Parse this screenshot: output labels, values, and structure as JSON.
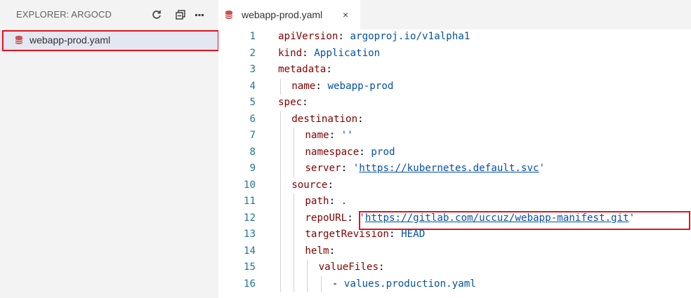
{
  "sidebar": {
    "title": "EXPLORER: ARGOCD",
    "files": [
      {
        "label": "webapp-prod.yaml",
        "selected": true,
        "highlighted": true
      }
    ],
    "header_icons": [
      "refresh-icon",
      "collapse-all-icon",
      "more-icon"
    ]
  },
  "tab": {
    "label": "webapp-prod.yaml",
    "close": "×"
  },
  "editor": {
    "lines": [
      {
        "n": "1",
        "key": "apiVersion",
        "sep": ": ",
        "val": "argoproj.io/v1alpha1"
      },
      {
        "n": "2",
        "key": "kind",
        "sep": ": ",
        "val": "Application"
      },
      {
        "n": "3",
        "key": "metadata",
        "sep": ":",
        "val": ""
      },
      {
        "n": "4",
        "key": "name",
        "sep": ": ",
        "val": "webapp-prod"
      },
      {
        "n": "5",
        "key": "spec",
        "sep": ":",
        "val": ""
      },
      {
        "n": "6",
        "key": "destination",
        "sep": ":",
        "val": ""
      },
      {
        "n": "7",
        "key": "name",
        "sep": ": ",
        "val": "''"
      },
      {
        "n": "8",
        "key": "namespace",
        "sep": ": ",
        "val": "prod"
      },
      {
        "n": "9",
        "key": "server",
        "sep": ": ",
        "q1": "'",
        "url": "https://kubernetes.default.svc",
        "q2": "'"
      },
      {
        "n": "10",
        "key": "source",
        "sep": ":",
        "val": ""
      },
      {
        "n": "11",
        "key": "path",
        "sep": ": ",
        "val": "."
      },
      {
        "n": "12",
        "key": "repoURL",
        "sep": ": ",
        "q1": "'",
        "url": "https://gitlab.com/uccuz/webapp-manifest.git",
        "q2": "'",
        "highlighted": true
      },
      {
        "n": "13",
        "key": "targetRevision",
        "sep": ": ",
        "val": "HEAD"
      },
      {
        "n": "14",
        "key": "helm",
        "sep": ":",
        "val": ""
      },
      {
        "n": "15",
        "key": "valueFiles",
        "sep": ":",
        "val": ""
      },
      {
        "n": "16",
        "dash": "- ",
        "val": "values.production.yaml"
      }
    ]
  },
  "colors": {
    "highlight_box": "#e0141e",
    "key": "#800000",
    "value": "#0451a5",
    "line_number": "#237893",
    "sidebar_bg": "#f3f3f3",
    "selected_bg": "#e4e6f1"
  }
}
